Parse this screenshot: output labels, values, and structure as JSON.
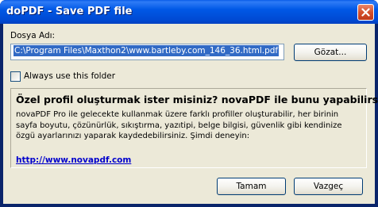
{
  "window": {
    "title": "doPDF - Save PDF file",
    "close_label": "Close"
  },
  "file": {
    "label": "Dosya Adı:",
    "value": "C:\\Program Files\\Maxthon2\\www.bartleby.com_146_36.html.pdf",
    "browse_label": "Gözat..."
  },
  "options": {
    "always_use_folder_label": "Always use this folder",
    "always_use_folder_checked": false
  },
  "promo": {
    "heading": "Özel profil oluşturmak ister misiniz? novaPDF ile bunu yapabilirsiniz.",
    "body": "novaPDF Pro ile gelecekte kullanmak üzere farklı profiller oluşturabilir, her birinin sayfa boyutu, çözünürlük, sıkıştırma, yazıtipi, belge bilgisi, güvenlik gibi kendinize özgü ayarlarınızı yaparak kaydedebilirsiniz. Şimdi deneyin:",
    "link": "http://www.novapdf.com"
  },
  "buttons": {
    "ok_label": "Tamam",
    "cancel_label": "Vazgeç"
  },
  "colors": {
    "titlebar": "#0058e6",
    "dialog_bg": "#ece9d8",
    "selection": "#316ac5",
    "link": "#0000cc"
  }
}
